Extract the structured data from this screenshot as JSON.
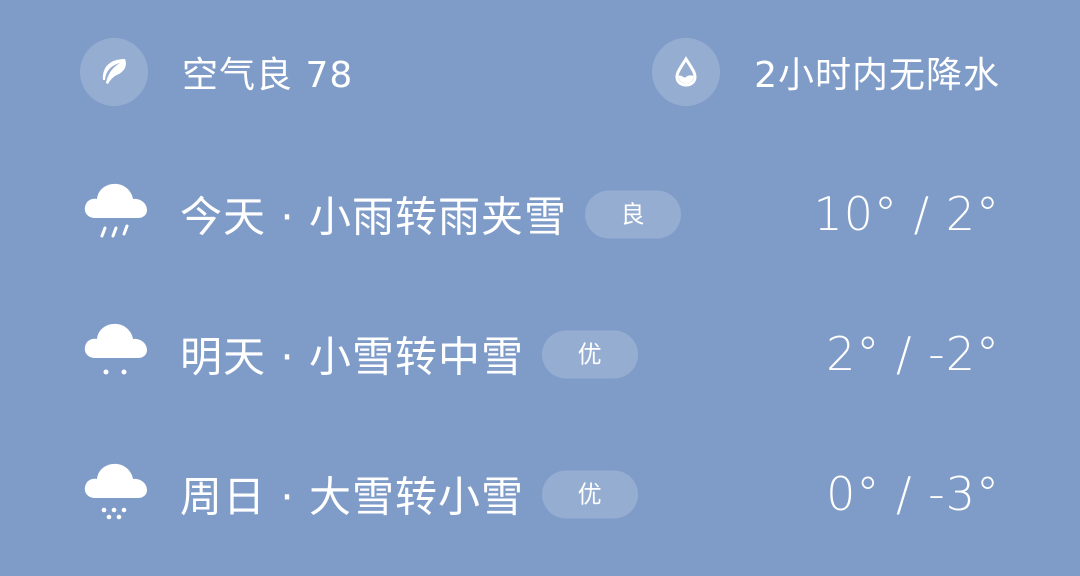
{
  "air": {
    "label": "空气良 78",
    "icon": "leaf-icon"
  },
  "precip": {
    "label": "2小时内无降水",
    "icon": "water-drop-icon"
  },
  "forecast": [
    {
      "text": "今天 · 小雨转雨夹雪",
      "aqi": "良",
      "temp": "10° / 2°",
      "icon": "sleet-cloud-icon"
    },
    {
      "text": "明天 · 小雪转中雪",
      "aqi": "优",
      "temp": "2° / -2°",
      "icon": "light-snow-cloud-icon"
    },
    {
      "text": "周日 · 大雪转小雪",
      "aqi": "优",
      "temp": "0° / -3°",
      "icon": "heavy-snow-cloud-icon"
    }
  ],
  "colors": {
    "background": "#7f9cc8",
    "text": "#ffffff"
  }
}
